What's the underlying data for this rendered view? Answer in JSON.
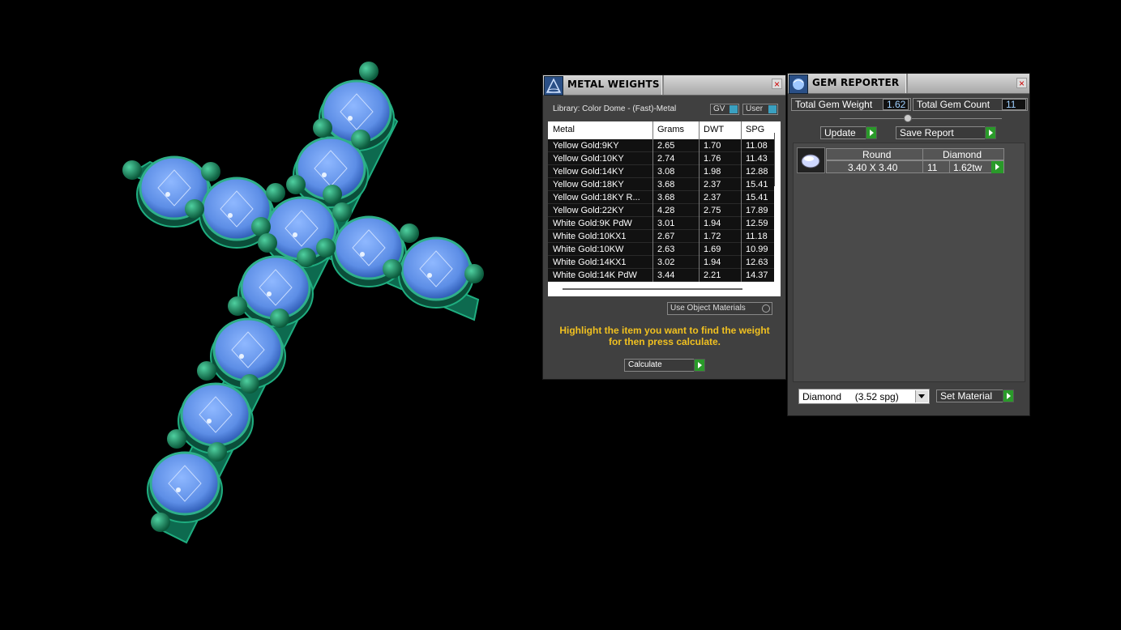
{
  "metal_weights": {
    "title": "METAL WEIGHTS",
    "close_label": "×",
    "library_label": "Library: Color Dome - (Fast)-Metal",
    "toggle_gv": "GV",
    "toggle_user": "User",
    "columns": [
      "Metal",
      "Grams",
      "DWT",
      "SPG"
    ],
    "rows": [
      {
        "metal": "Yellow Gold:9KY",
        "grams": "2.65",
        "dwt": "1.70",
        "spg": "11.08"
      },
      {
        "metal": "Yellow Gold:10KY",
        "grams": "2.74",
        "dwt": "1.76",
        "spg": "11.43"
      },
      {
        "metal": "Yellow Gold:14KY",
        "grams": "3.08",
        "dwt": "1.98",
        "spg": "12.88"
      },
      {
        "metal": "Yellow Gold:18KY",
        "grams": "3.68",
        "dwt": "2.37",
        "spg": "15.41"
      },
      {
        "metal": "Yellow Gold:18KY R...",
        "grams": "3.68",
        "dwt": "2.37",
        "spg": "15.41"
      },
      {
        "metal": "Yellow Gold:22KY",
        "grams": "4.28",
        "dwt": "2.75",
        "spg": "17.89"
      },
      {
        "metal": "White Gold:9K PdW",
        "grams": "3.01",
        "dwt": "1.94",
        "spg": "12.59"
      },
      {
        "metal": "White Gold:10KX1",
        "grams": "2.67",
        "dwt": "1.72",
        "spg": "11.18"
      },
      {
        "metal": "White Gold:10KW",
        "grams": "2.63",
        "dwt": "1.69",
        "spg": "10.99"
      },
      {
        "metal": "White Gold:14KX1",
        "grams": "3.02",
        "dwt": "1.94",
        "spg": "12.63"
      },
      {
        "metal": "White Gold:14K PdW",
        "grams": "3.44",
        "dwt": "2.21",
        "spg": "14.37"
      }
    ],
    "use_object_materials": "Use Object Materials",
    "instruction": "Highlight the item you want to find the weight for then press calculate.",
    "calculate_label": "Calculate"
  },
  "gem_reporter": {
    "title": "GEM REPORTER",
    "close_label": "×",
    "total_weight_label": "Total Gem Weight",
    "total_weight_value": "1.62",
    "total_count_label": "Total Gem Count",
    "total_count_value": "11",
    "update_label": "Update",
    "save_report_label": "Save Report",
    "gem_row": {
      "shape": "Round",
      "material": "Diamond",
      "size": "3.40 X 3.40",
      "count": "11",
      "weight": "1.62tw"
    },
    "material_select": "Diamond     (3.52 spg)",
    "set_material_label": "Set Material"
  }
}
